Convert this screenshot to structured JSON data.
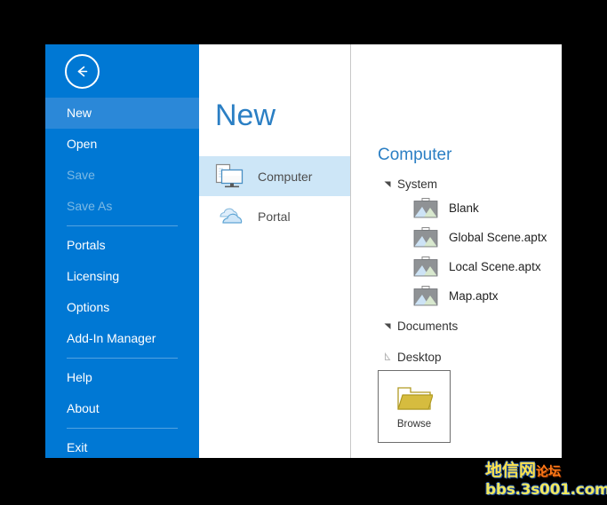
{
  "window": {
    "sidebar_color": "#0078d4",
    "selected_color": "#2b88d8",
    "accent_color": "#2b7fc4"
  },
  "sidebar": {
    "back_icon": "back-arrow-icon",
    "items": [
      {
        "label": "New",
        "state": "selected"
      },
      {
        "label": "Open",
        "state": "normal"
      },
      {
        "label": "Save",
        "state": "disabled"
      },
      {
        "label": "Save As",
        "state": "disabled"
      },
      {
        "separator_after": true
      },
      {
        "label": "Portals",
        "state": "normal"
      },
      {
        "label": "Licensing",
        "state": "normal"
      },
      {
        "label": "Options",
        "state": "normal"
      },
      {
        "label": "Add-In Manager",
        "state": "normal"
      },
      {
        "separator_after": true
      },
      {
        "label": "Help",
        "state": "normal"
      },
      {
        "label": "About",
        "state": "normal"
      },
      {
        "separator_after": true
      },
      {
        "label": "Exit",
        "state": "normal"
      }
    ]
  },
  "middle": {
    "title": "New",
    "choices": [
      {
        "label": "Computer",
        "icon": "computer-icon",
        "selected": true
      },
      {
        "label": "Portal",
        "icon": "cloud-icon",
        "selected": false
      }
    ]
  },
  "right": {
    "title": "Computer",
    "tree": [
      {
        "label": "System",
        "expanded": true,
        "items": [
          {
            "label": "Blank",
            "icon": "project-thumbnail-icon"
          },
          {
            "label": "Global Scene.aptx",
            "icon": "project-thumbnail-icon"
          },
          {
            "label": "Local Scene.aptx",
            "icon": "project-thumbnail-icon"
          },
          {
            "label": "Map.aptx",
            "icon": "project-thumbnail-icon"
          }
        ]
      },
      {
        "label": "Documents",
        "expanded": true,
        "items": []
      },
      {
        "label": "Desktop",
        "expanded": false,
        "items": []
      }
    ],
    "browse": {
      "label": "Browse",
      "icon": "folder-icon"
    }
  },
  "watermark": {
    "line1_main": "地信网",
    "line1_sub": "论坛",
    "line2": "bbs.3s001.com"
  }
}
